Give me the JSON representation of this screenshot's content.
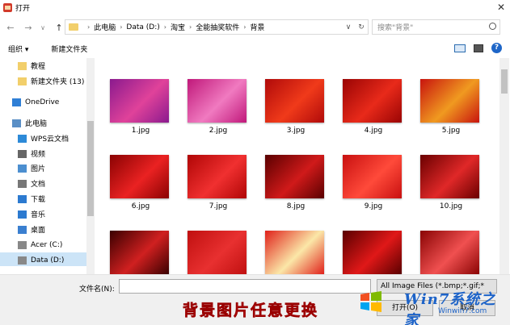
{
  "window": {
    "title": "打开",
    "close_glyph": "✕"
  },
  "nav": {
    "back": "←",
    "forward": "→",
    "dropdown": "∨",
    "up": "↑"
  },
  "address": {
    "crumbs": [
      "此电脑",
      "Data (D:)",
      "淘宝",
      "全能抽奖软件",
      "背景"
    ],
    "separator": "›",
    "dropdown_glyph": "∨",
    "refresh_glyph": "↻"
  },
  "search": {
    "placeholder": "搜索\"背景\""
  },
  "toolbar": {
    "organize": "组织 ▾",
    "new_folder": "新建文件夹",
    "help": "?"
  },
  "sidebar": {
    "items": [
      {
        "label": "教程",
        "icon": "folder-icon"
      },
      {
        "label": "新建文件夹 (13)",
        "icon": "folder-icon"
      },
      {
        "label": "OneDrive",
        "icon": "cloud-icon"
      },
      {
        "label": "此电脑",
        "icon": "computer-icon"
      },
      {
        "label": "WPS云文档",
        "icon": "wps-cloud-icon"
      },
      {
        "label": "视频",
        "icon": "video-icon"
      },
      {
        "label": "图片",
        "icon": "pictures-icon"
      },
      {
        "label": "文档",
        "icon": "documents-icon"
      },
      {
        "label": "下载",
        "icon": "download-icon"
      },
      {
        "label": "音乐",
        "icon": "music-icon"
      },
      {
        "label": "桌面",
        "icon": "desktop-icon"
      },
      {
        "label": "Acer (C:)",
        "icon": "drive-icon"
      },
      {
        "label": "Data (D:)",
        "icon": "drive-icon"
      }
    ]
  },
  "files": [
    {
      "name": "1.jpg",
      "colors": [
        "#8a1a8e",
        "#e0429a"
      ]
    },
    {
      "name": "2.jpg",
      "colors": [
        "#c0187a",
        "#f07ac0"
      ]
    },
    {
      "name": "3.jpg",
      "colors": [
        "#b00a0a",
        "#f03a1a"
      ]
    },
    {
      "name": "4.jpg",
      "colors": [
        "#9a0404",
        "#e82a1a"
      ]
    },
    {
      "name": "5.jpg",
      "colors": [
        "#c8140e",
        "#f09a20"
      ]
    },
    {
      "name": "6.jpg",
      "colors": [
        "#8a0202",
        "#ea2222"
      ]
    },
    {
      "name": "7.jpg",
      "colors": [
        "#b00606",
        "#f03030"
      ]
    },
    {
      "name": "8.jpg",
      "colors": [
        "#5a0000",
        "#d01a1a"
      ]
    },
    {
      "name": "9.jpg",
      "colors": [
        "#c81010",
        "#ff4a3a"
      ]
    },
    {
      "name": "10.jpg",
      "colors": [
        "#6a0000",
        "#e02828"
      ]
    },
    {
      "name": "",
      "colors": [
        "#3a0000",
        "#d02020"
      ]
    },
    {
      "name": "",
      "colors": [
        "#c01010",
        "#e83030"
      ]
    },
    {
      "name": "",
      "colors": [
        "#e0201a",
        "#fbe7a8"
      ]
    },
    {
      "name": "",
      "colors": [
        "#5a0000",
        "#e01818"
      ]
    },
    {
      "name": "",
      "colors": [
        "#8a0404",
        "#f05050"
      ]
    }
  ],
  "bottom": {
    "filename_label": "文件名(N):",
    "filename_value": "",
    "filter_value": "All Image Files (*.bmp;*.gif;*",
    "open_label": "打开(O)",
    "cancel_label": "取消"
  },
  "banner": {
    "text": "背景图片任意更换"
  },
  "watermark": {
    "brand": "Win7系统之家",
    "url": "Winwin7.com"
  }
}
